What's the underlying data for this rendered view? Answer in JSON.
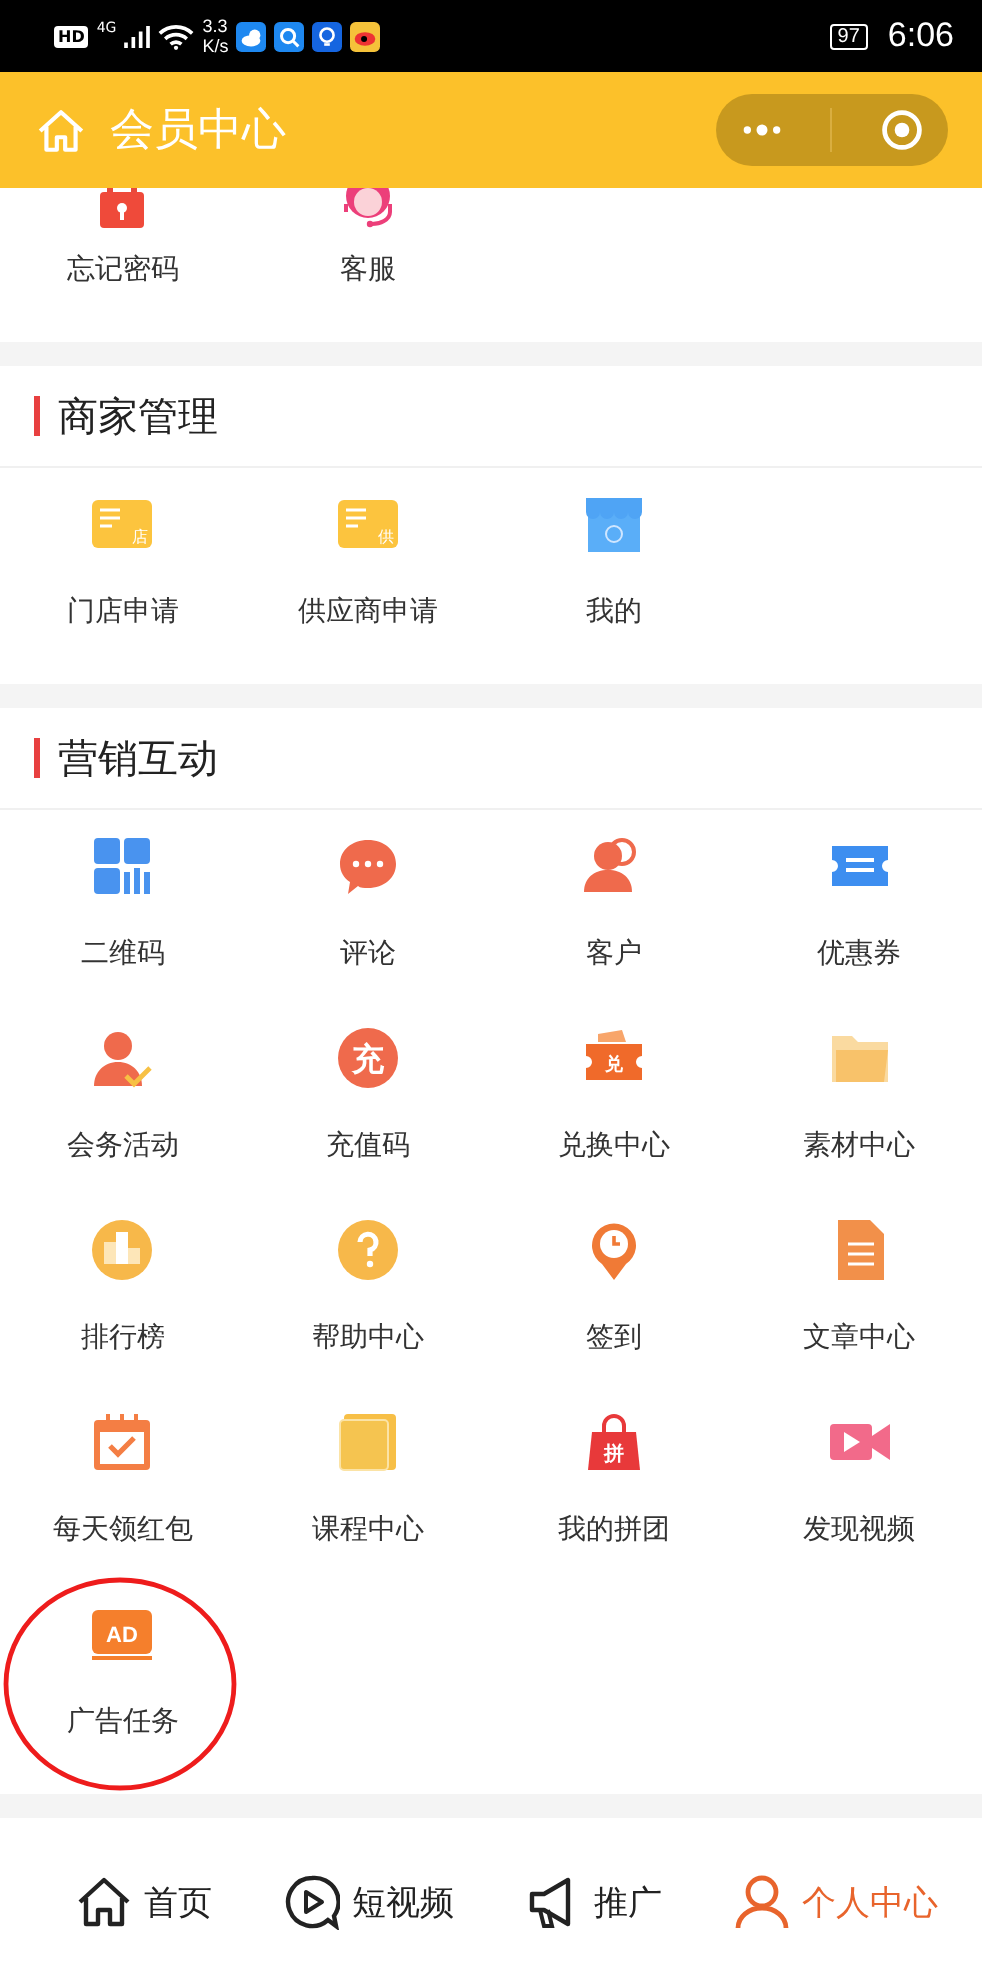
{
  "status_bar": {
    "hd": "HD",
    "network": "4G",
    "speed": "3.3",
    "speed_unit": "K/s",
    "battery": "97",
    "time": "6:06"
  },
  "header": {
    "title": "会员中心"
  },
  "top_row": [
    {
      "label": "忘记密码"
    },
    {
      "label": "客服"
    }
  ],
  "sections": [
    {
      "title": "商家管理",
      "items": [
        {
          "label": "门店申请",
          "badge": "店"
        },
        {
          "label": "供应商申请",
          "badge": "供"
        },
        {
          "label": "我的"
        }
      ]
    },
    {
      "title": "营销互动",
      "items": [
        {
          "label": "二维码"
        },
        {
          "label": "评论"
        },
        {
          "label": "客户"
        },
        {
          "label": "优惠券"
        },
        {
          "label": "会务活动"
        },
        {
          "label": "充值码",
          "badge": "充"
        },
        {
          "label": "兑换中心",
          "badge": "兑"
        },
        {
          "label": "素材中心"
        },
        {
          "label": "排行榜"
        },
        {
          "label": "帮助中心"
        },
        {
          "label": "签到"
        },
        {
          "label": "文章中心"
        },
        {
          "label": "每天领红包"
        },
        {
          "label": "课程中心"
        },
        {
          "label": "我的拼团",
          "badge": "拼"
        },
        {
          "label": "发现视频"
        },
        {
          "label": "广告任务",
          "badge": "AD",
          "circled": true
        }
      ]
    }
  ],
  "tabs": [
    {
      "label": "首页",
      "selected": false
    },
    {
      "label": "短视频",
      "selected": false
    },
    {
      "label": "推广",
      "selected": false
    },
    {
      "label": "个人中心",
      "selected": true
    }
  ]
}
